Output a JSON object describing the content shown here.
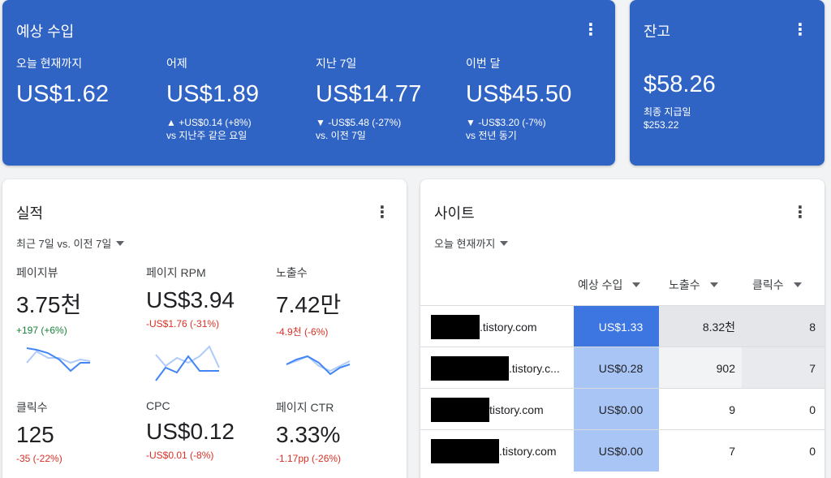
{
  "colors": {
    "card_blue": "#2f63c4",
    "up": "#188038",
    "down": "#d93025",
    "earn_dark": "#3d76e0",
    "earn_light": "#a9c5f5",
    "gray_dark": "#e4e6ea",
    "gray_light": "#f1f3f4"
  },
  "earnings": {
    "title": "예상 수입",
    "menu_icon": "more-vert-icon",
    "metrics": [
      {
        "label": "오늘 현재까지",
        "value": "US$1.62",
        "change": "",
        "compare": ""
      },
      {
        "label": "어제",
        "value": "US$1.89",
        "change": "▲ +US$0.14 (+8%)",
        "compare": "vs 지난주 같은 요일"
      },
      {
        "label": "지난 7일",
        "value": "US$14.77",
        "change": "▼ -US$5.48 (-27%)",
        "compare": "vs. 이전 7일"
      },
      {
        "label": "이번 달",
        "value": "US$45.50",
        "change": "▼ -US$3.20 (-7%)",
        "compare": "vs 전년 동기"
      }
    ]
  },
  "balance": {
    "title": "잔고",
    "value": "$58.26",
    "last_payment_label": "최종 지급일",
    "last_payment_value": "$253.22"
  },
  "performance": {
    "title": "실적",
    "range": "최근 7일 vs. 이전 7일",
    "metrics": [
      {
        "label": "페이지뷰",
        "value": "3.75천",
        "change": "+197 (+6%)",
        "trend": "up"
      },
      {
        "label": "페이지 RPM",
        "value": "US$3.94",
        "change": "-US$1.76 (-31%)",
        "trend": "down"
      },
      {
        "label": "노출수",
        "value": "7.42만",
        "change": "-4.9천 (-6%)",
        "trend": "down"
      },
      {
        "label": "클릭수",
        "value": "125",
        "change": "-35 (-22%)",
        "trend": "down"
      },
      {
        "label": "CPC",
        "value": "US$0.12",
        "change": "-US$0.01 (-8%)",
        "trend": "down"
      },
      {
        "label": "페이지 CTR",
        "value": "3.33%",
        "change": "-1.17pp (-26%)",
        "trend": "down"
      }
    ]
  },
  "sites": {
    "title": "사이트",
    "range": "오늘 현재까지",
    "columns": [
      "예상 수입",
      "노출수",
      "클릭수"
    ],
    "rows": [
      {
        "site": ".tistory.com",
        "earnings": "US$1.33",
        "impressions": "8.32천",
        "clicks": "8"
      },
      {
        "site": ".tistory.c...",
        "earnings": "US$0.28",
        "impressions": "902",
        "clicks": "7"
      },
      {
        "site": "tistory.com",
        "earnings": "US$0.00",
        "impressions": "9",
        "clicks": "0"
      },
      {
        "site": ".tistory.com",
        "earnings": "US$0.00",
        "impressions": "7",
        "clicks": "0"
      }
    ]
  }
}
